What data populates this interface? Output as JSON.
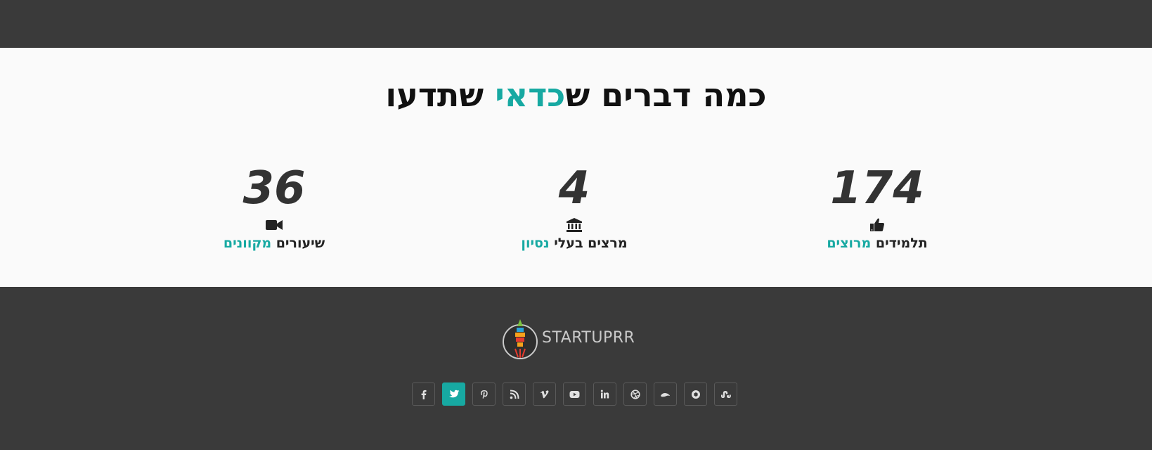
{
  "colors": {
    "accent": "#17a9a2",
    "dark_bg": "#3a3a3a",
    "section_bg": "#fafafa"
  },
  "section": {
    "title_part1": "כמה דברים ש",
    "title_accent": "כדאי",
    "title_part2": " שתדעו"
  },
  "stats": [
    {
      "number": "174",
      "icon": "thumbs-up-icon",
      "label_main": "תלמידים ",
      "label_accent": "מרוצים"
    },
    {
      "number": "4",
      "icon": "institution-icon",
      "label_main": "מרצים בעלי ",
      "label_accent": "נסיון"
    },
    {
      "number": "36",
      "icon": "video-camera-icon",
      "label_main": "שיעורים ",
      "label_accent": "מקוונים"
    }
  ],
  "footer": {
    "logo_text": "STARTUPRR",
    "social": [
      "facebook-icon",
      "twitter-icon",
      "pinterest-icon",
      "rss-icon",
      "vimeo-icon",
      "youtube-icon",
      "linkedin-icon",
      "dribbble-icon",
      "skype-icon",
      "picasa-icon",
      "stumbleupon-icon"
    ],
    "active_social": "twitter-icon"
  }
}
